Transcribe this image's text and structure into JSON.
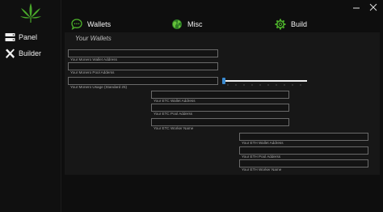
{
  "sidebar": {
    "logo": "cannabis-leaf-logo",
    "items": [
      {
        "label": "Panel",
        "icon": "panel-icon"
      },
      {
        "label": "Builder",
        "icon": "wrench-icon"
      }
    ]
  },
  "window": {
    "controls": [
      "minimize-icon",
      "close-icon"
    ]
  },
  "tabs": [
    {
      "label": "Wallets",
      "icon": "chat-icon"
    },
    {
      "label": "Misc",
      "icon": "globe-icon"
    },
    {
      "label": "Build",
      "icon": "gear-icon"
    }
  ],
  "wallets": {
    "title": "Your Wallets",
    "monero": {
      "wallet_placeholder": "Your Monero Wallet Address",
      "pool_placeholder": "Your Monero Pool Adderss",
      "usage_placeholder": "Your Monero Usage (Standard 25)",
      "usage_level_percent": 0
    },
    "etc": {
      "wallet_placeholder": "Your ETC Wallet Address",
      "pool_placeholder": "Your ETC Pool Adderss",
      "worker_placeholder": "Your ETC Worker Name"
    },
    "eth": {
      "wallet_placeholder": "Your ETH Wallet Address",
      "pool_placeholder": "Your ETH Pool Adderss",
      "worker_placeholder": "Your ETH Worker Name"
    }
  },
  "colors": {
    "background": "#0e0e0e",
    "panel": "#171717",
    "accent_green": "#4caf2a",
    "slider_blue": "#2d7fc1"
  }
}
